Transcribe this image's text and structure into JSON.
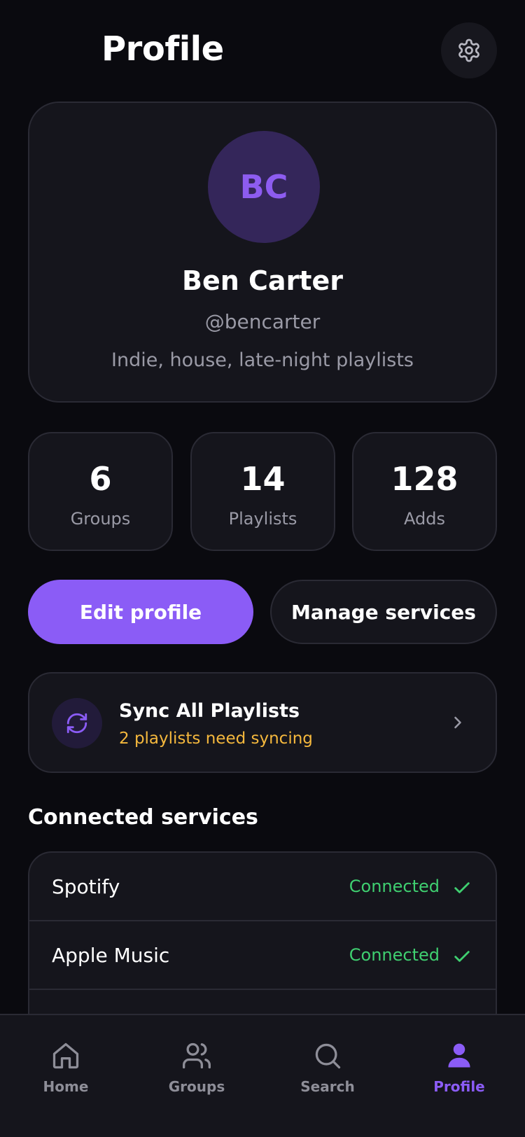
{
  "header": {
    "title": "Profile",
    "settings_icon": "gear-icon"
  },
  "profile": {
    "initials": "BC",
    "name": "Ben Carter",
    "handle": "@bencarter",
    "bio": "Indie, house, late-night playlists"
  },
  "stats": [
    {
      "value": "6",
      "label": "Groups"
    },
    {
      "value": "14",
      "label": "Playlists"
    },
    {
      "value": "128",
      "label": "Adds"
    }
  ],
  "actions": {
    "edit_label": "Edit profile",
    "manage_label": "Manage services"
  },
  "sync": {
    "title": "Sync All Playlists",
    "subtitle": "2 playlists need syncing",
    "icon": "sync-icon"
  },
  "services": {
    "section_title": "Connected services",
    "items": [
      {
        "name": "Spotify",
        "status": "Connected"
      },
      {
        "name": "Apple Music",
        "status": "Connected"
      }
    ]
  },
  "tabbar": {
    "tabs": [
      {
        "label": "Home",
        "icon": "home-icon"
      },
      {
        "label": "Groups",
        "icon": "groups-icon"
      },
      {
        "label": "Search",
        "icon": "search-icon"
      },
      {
        "label": "Profile",
        "icon": "profile-icon",
        "active": true
      }
    ]
  },
  "colors": {
    "accent": "#8b5cf6",
    "background": "#0a0a0f",
    "card": "#15151c",
    "warning": "#f5b83d",
    "success": "#3fcf70"
  }
}
